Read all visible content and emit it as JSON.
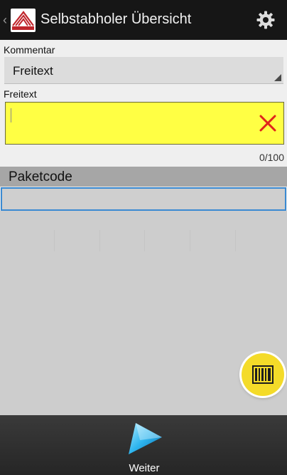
{
  "titlebar": {
    "back": "‹",
    "title": "Selbstabholer Übersicht"
  },
  "form": {
    "kommentar_label": "Kommentar",
    "kommentar_value": "Freitext",
    "freitext_label": "Freitext",
    "freitext_value": "",
    "counter": "0/100"
  },
  "paket": {
    "title": "Paketcode",
    "value": ""
  },
  "footer": {
    "weiter_label": "Weiter"
  },
  "colors": {
    "field_highlight": "#ffff44",
    "accent": "#3a8ad2",
    "fab": "#f4db29",
    "clear": "#e0241b"
  },
  "icons": [
    "app-logo-icon",
    "gear-icon",
    "clear-x-icon",
    "barcode-icon",
    "play-icon"
  ]
}
